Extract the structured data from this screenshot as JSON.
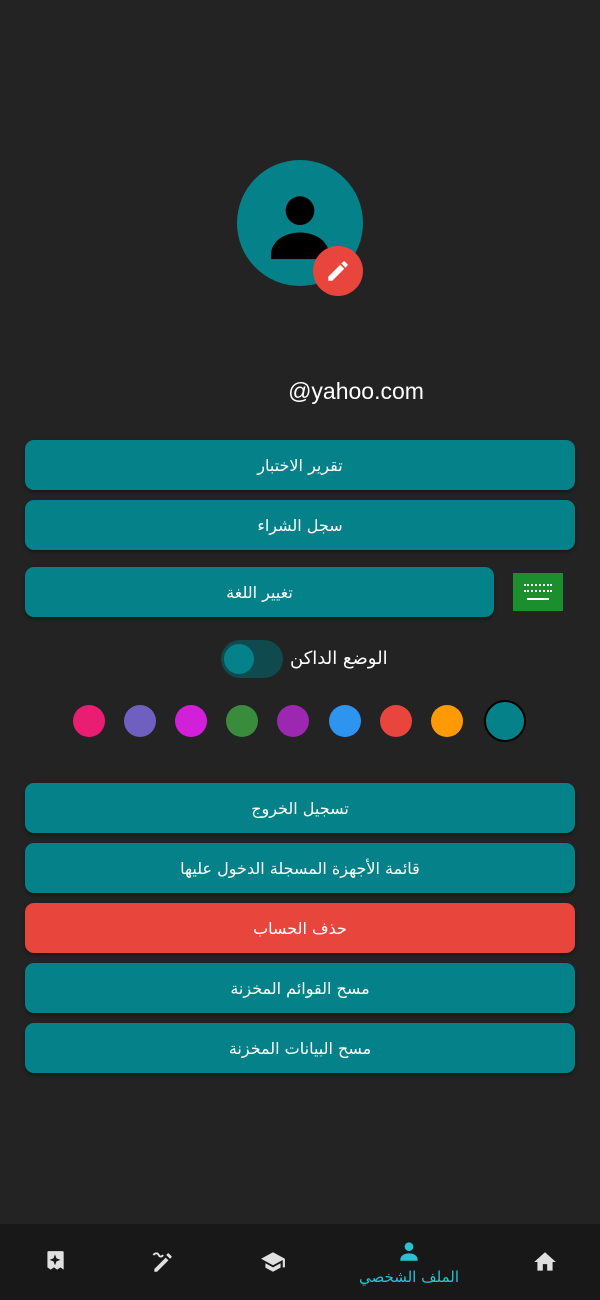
{
  "profile": {
    "email": "@yahoo.com",
    "avatar_icon": "person-icon",
    "edit_icon": "pencil-icon"
  },
  "buttons": {
    "test_report": "تقرير الاختبار",
    "purchase_history": "سجل الشراء",
    "change_language": "تغيير اللغة",
    "logout": "تسجيل الخروج",
    "devices_list": "قائمة الأجهزة المسجلة الدخول عليها",
    "delete_account": "حذف الحساب",
    "clear_lists": "مسح القوائم المخزنة",
    "clear_data": "مسح البيانات المخزنة"
  },
  "language_flag": "saudi-flag-icon",
  "dark_mode": {
    "label": "الوضع الداكن",
    "enabled": false
  },
  "theme_colors": [
    "#e91e73",
    "#6f5fbf",
    "#d21fd9",
    "#398c3c",
    "#9c27b0",
    "#2d95f0",
    "#e8453c",
    "#ff9a05",
    "#05818a"
  ],
  "selected_color": "#05818a",
  "colors": {
    "background": "#232323",
    "primary": "#05818a",
    "danger": "#e8453c",
    "nav_active": "#27c3d4"
  },
  "bottom_nav": {
    "items": [
      {
        "icon": "sparkle-card-icon",
        "label": ""
      },
      {
        "icon": "edit-pen-icon",
        "label": ""
      },
      {
        "icon": "graduation-cap-icon",
        "label": ""
      },
      {
        "icon": "profile-icon",
        "label": "الملف الشخصي",
        "active": true
      },
      {
        "icon": "home-icon",
        "label": ""
      }
    ]
  }
}
